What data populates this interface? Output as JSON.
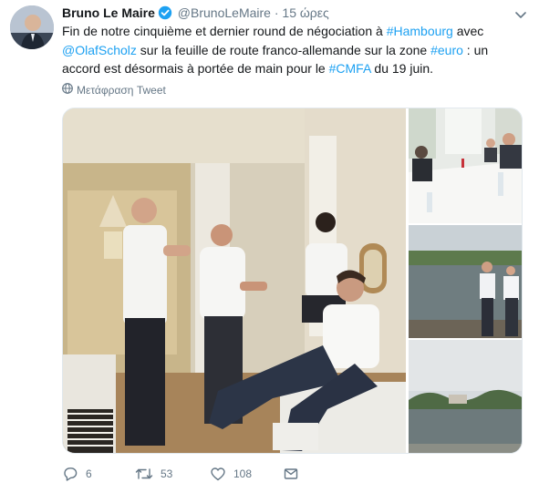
{
  "author": {
    "name": "Bruno Le Maire",
    "handle": "@BrunoLeMaire",
    "separator": "·",
    "time": "15 ώρες"
  },
  "tweet": {
    "segments": [
      {
        "text": "Fin de notre cinquième et dernier round de négociation à ",
        "link": false
      },
      {
        "text": "#Hambourg",
        "link": true
      },
      {
        "text": " avec ",
        "link": false
      },
      {
        "text": "@OlafScholz",
        "link": true
      },
      {
        "text": " sur la feuille de route franco-allemande sur la zone ",
        "link": false
      },
      {
        "text": "#euro",
        "link": true
      },
      {
        "text": " : un accord est désormais à portée de main pour le ",
        "link": false
      },
      {
        "text": "#CMFA",
        "link": true
      },
      {
        "text": " du 19 juin.",
        "link": false
      }
    ],
    "translate_label": "Μετάφραση Tweet"
  },
  "actions": {
    "replies": "6",
    "retweets": "53",
    "likes": "108"
  },
  "colors": {
    "link": "#1da1f2",
    "secondary": "#657786",
    "verified": "#1da1f2"
  },
  "icons": [
    "verified-badge-icon",
    "caret-down-icon",
    "globe-icon",
    "reply-icon",
    "retweet-icon",
    "like-icon",
    "direct-message-icon"
  ]
}
